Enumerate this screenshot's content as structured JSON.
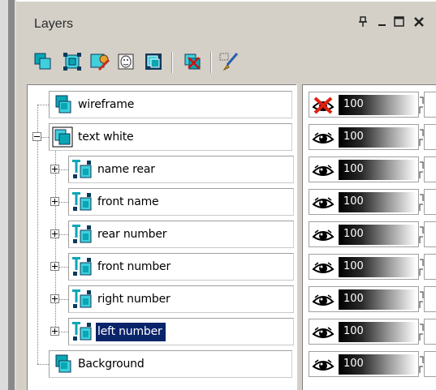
{
  "panel": {
    "title": "Layers",
    "controls": [
      "ᵖ",
      "–",
      "☐",
      "✕"
    ]
  },
  "toolbar": {
    "buttons": [
      {
        "name": "new-raster-layer",
        "icon": "new-layer-icon"
      },
      {
        "name": "new-group",
        "icon": "new-group-icon"
      },
      {
        "name": "layer-properties",
        "icon": "layer-properties-icon"
      },
      {
        "name": "layer-mask",
        "icon": "mask-icon"
      },
      {
        "name": "merge-layers",
        "icon": "merge-icon"
      },
      {
        "name": "delete-layer",
        "icon": "delete-layer-icon"
      },
      {
        "name": "edit-layer",
        "icon": "paint-brush-icon"
      }
    ]
  },
  "layers": [
    {
      "label": "wireframe",
      "indent": 0,
      "expander": "none",
      "type": "vector",
      "visible": false,
      "opacity": "100",
      "selected": false
    },
    {
      "label": "text white",
      "indent": 0,
      "expander": "minus",
      "type": "group",
      "visible": true,
      "opacity": "100",
      "selected": false
    },
    {
      "label": "name rear",
      "indent": 1,
      "expander": "plus",
      "type": "text",
      "visible": true,
      "opacity": "100",
      "selected": false
    },
    {
      "label": "front name",
      "indent": 1,
      "expander": "plus",
      "type": "text",
      "visible": true,
      "opacity": "100",
      "selected": false
    },
    {
      "label": "rear number",
      "indent": 1,
      "expander": "plus",
      "type": "text",
      "visible": true,
      "opacity": "100",
      "selected": false
    },
    {
      "label": "front number",
      "indent": 1,
      "expander": "plus",
      "type": "text",
      "visible": true,
      "opacity": "100",
      "selected": false
    },
    {
      "label": "right number",
      "indent": 1,
      "expander": "plus",
      "type": "text",
      "visible": true,
      "opacity": "100",
      "selected": false
    },
    {
      "label": "left number",
      "indent": 1,
      "expander": "plus",
      "type": "text",
      "visible": true,
      "opacity": "100",
      "selected": true
    },
    {
      "label": "Background",
      "indent": 0,
      "expander": "none",
      "type": "vector",
      "visible": true,
      "opacity": "100",
      "selected": false
    }
  ],
  "colors": {
    "selection": "#0a246a",
    "layer_icon": "#0aa6b4",
    "panel_bg": "#d4d0c8"
  }
}
